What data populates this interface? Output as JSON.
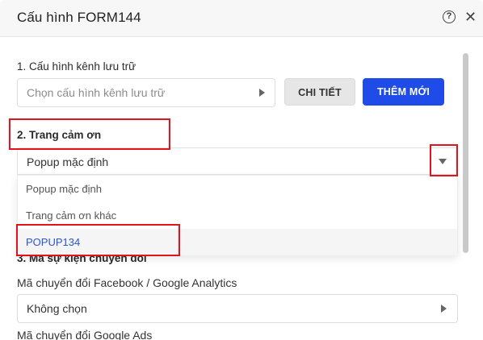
{
  "modal": {
    "title": "Cấu hình FORM144",
    "help_icon": "question-circle-icon",
    "close_icon": "close-icon"
  },
  "section1": {
    "label": "1. Cấu hình kênh lưu trữ",
    "select_placeholder": "Chọn cấu hình kênh lưu trữ",
    "detail_button": "CHI TIẾT",
    "new_button": "THÊM MỚI"
  },
  "section2": {
    "label": "2. Trang cảm ơn",
    "selected_value": "Popup mặc định",
    "options": [
      {
        "label": "Popup mặc định"
      },
      {
        "label": "Trang cảm ơn khác"
      },
      {
        "label": "POPUP134"
      }
    ]
  },
  "section3": {
    "label": "3. Mã sự kiện chuyển đổi",
    "facebook_label": "Mã chuyển đổi Facebook / Google Analytics",
    "facebook_value": "Không chọn",
    "google_ads_label": "Mã chuyển đổi Google Ads"
  },
  "colors": {
    "primary_button": "#1f4be8",
    "highlight": "#e3121b",
    "selected_option_text": "#2b55c9"
  }
}
